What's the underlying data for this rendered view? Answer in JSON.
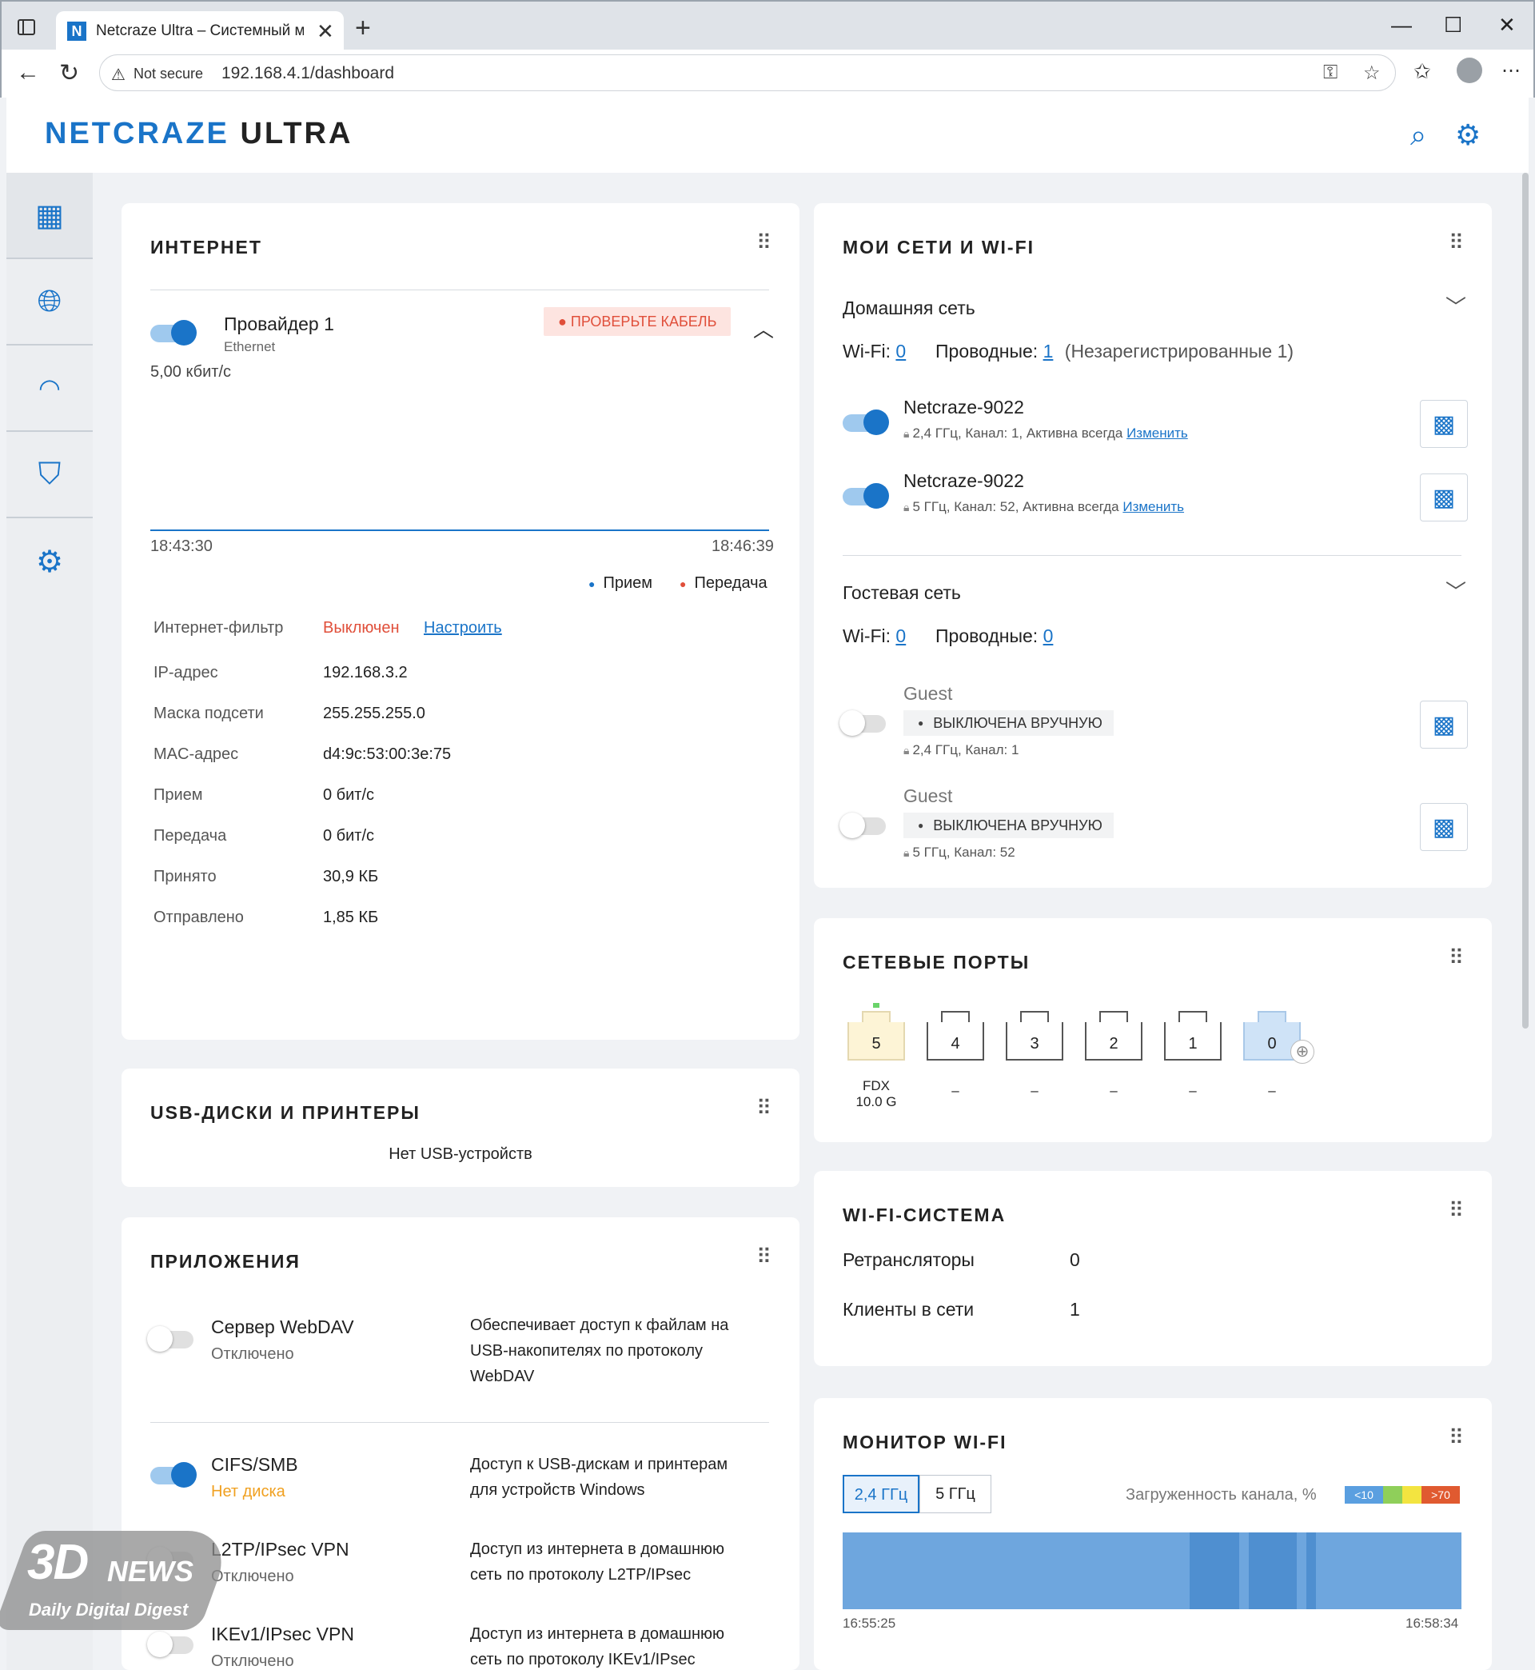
{
  "browser": {
    "tab_title": "Netcraze Ultra – Системный мон",
    "tab_favicon": "N",
    "not_secure": "Not secure",
    "url": "192.168.4.1/dashboard"
  },
  "header": {
    "logo_part1": "NETCRAZE",
    "logo_part2": "ULTRA"
  },
  "internet": {
    "title": "ИНТЕРНЕТ",
    "provider_name": "Провайдер 1",
    "provider_type": "Ethernet",
    "status_badge": "ПРОВЕРЬТЕ КАБЕЛЬ",
    "speed": "5,00 кбит/с",
    "time_start": "18:43:30",
    "time_end": "18:46:39",
    "legend_rx": "Прием",
    "legend_tx": "Передача",
    "rows": [
      {
        "label": "Интернет-фильтр",
        "value": "Выключен",
        "link": "Настроить"
      },
      {
        "label": "IP-адрес",
        "value": "192.168.3.2"
      },
      {
        "label": "Маска подсети",
        "value": "255.255.255.0"
      },
      {
        "label": "MAC-адрес",
        "value": "d4:9c:53:00:3e:75"
      },
      {
        "label": "Прием",
        "value": "0 бит/с"
      },
      {
        "label": "Передача",
        "value": "0 бит/с"
      },
      {
        "label": "Принято",
        "value": "30,9 КБ"
      },
      {
        "label": "Отправлено",
        "value": "1,85 КБ"
      }
    ]
  },
  "usb": {
    "title": "USB-ДИСКИ И ПРИНТЕРЫ",
    "empty": "Нет USB-устройств"
  },
  "apps": {
    "title": "ПРИЛОЖЕНИЯ",
    "items": [
      {
        "name": "Сервер WebDAV",
        "status": "Отключено",
        "desc1": "Обеспечивает доступ к файлам на",
        "desc2": "USB-накопителях по протоколу",
        "desc3": "WebDAV"
      },
      {
        "name": "CIFS/SMB",
        "status": "Нет диска",
        "desc1": "Доступ к USB-дискам и принтерам",
        "desc2": "для устройств Windows"
      },
      {
        "name": "L2TP/IPsec VPN",
        "status": "Отключено",
        "desc1": "Доступ из интернета в домашнюю",
        "desc2": "сеть по протоколу L2TP/IPsec"
      },
      {
        "name": "IKEv1/IPsec VPN",
        "status": "Отключено",
        "desc1": "Доступ из интернета в домашнюю",
        "desc2": "сеть по протоколу IKEv1/IPsec"
      }
    ]
  },
  "networks": {
    "title": "МОИ СЕТИ И WI-FI",
    "home": {
      "title": "Домашняя сеть",
      "wifi_label": "Wi-Fi:",
      "wifi_count": "0",
      "wired_label": "Проводные:",
      "wired_count": "1",
      "unregistered": "(Незарегистрированные 1)",
      "ssids": [
        {
          "name": "Netcraze-9022",
          "info": "2,4 ГГц,  Канал: 1, Активна всегда",
          "link": "Изменить"
        },
        {
          "name": "Netcraze-9022",
          "info": "5 ГГц,  Канал: 52, Активна всегда",
          "link": "Изменить"
        }
      ]
    },
    "guest": {
      "title": "Гостевая сеть",
      "wifi_label": "Wi-Fi:",
      "wifi_count": "0",
      "wired_label": "Проводные:",
      "wired_count": "0",
      "ssids": [
        {
          "name": "Guest",
          "badge": "ВЫКЛЮЧЕНА ВРУЧНУЮ",
          "info": "2,4 ГГц,  Канал: 1"
        },
        {
          "name": "Guest",
          "badge": "ВЫКЛЮЧЕНА ВРУЧНУЮ",
          "info": "5 ГГц,  Канал: 52"
        }
      ]
    }
  },
  "ports": {
    "title": "СЕТЕВЫЕ ПОРТЫ",
    "items": [
      {
        "num": "5",
        "label1": "FDX",
        "label2": "10.0 G"
      },
      {
        "num": "4",
        "label1": "–"
      },
      {
        "num": "3",
        "label1": "–"
      },
      {
        "num": "2",
        "label1": "–"
      },
      {
        "num": "1",
        "label1": "–"
      },
      {
        "num": "0",
        "label1": "–"
      }
    ]
  },
  "wifi_system": {
    "title": "WI-FI-СИСТЕМА",
    "repeaters_label": "Ретрансляторы",
    "repeaters_value": "0",
    "clients_label": "Клиенты в сети",
    "clients_value": "1"
  },
  "wifi_monitor": {
    "title": "МОНИТОР WI-FI",
    "tab_24": "2,4 ГГц",
    "tab_5": "5 ГГц",
    "load_label": "Загруженность канала, %",
    "scale_low": "<10",
    "scale_high": ">70",
    "time_start": "16:55:25",
    "time_end": "16:58:34"
  },
  "colors": {
    "accent": "#1a74c8",
    "error": "#e04f3a",
    "warning": "#f0a020"
  }
}
